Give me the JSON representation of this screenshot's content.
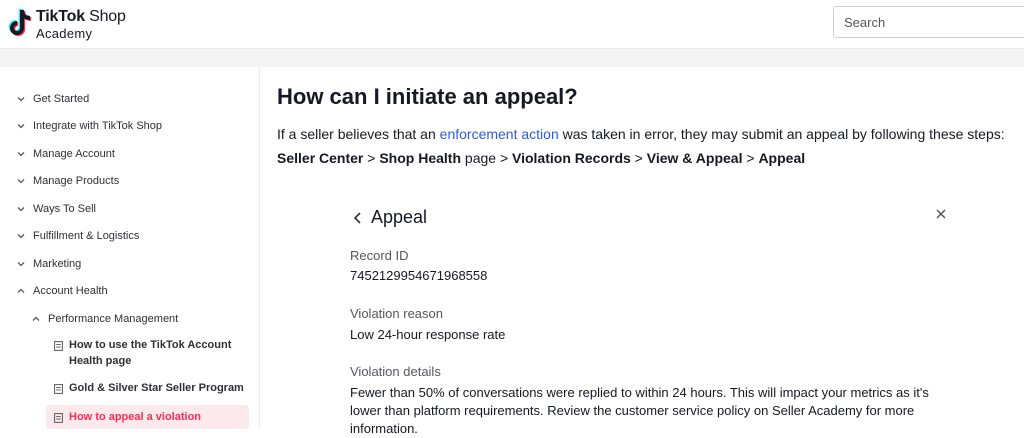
{
  "header": {
    "logo_bold": "TikTok",
    "logo_thin": " Shop",
    "logo_sub": "Academy",
    "search_placeholder": "Search"
  },
  "sidebar": {
    "items": [
      {
        "label": "Get Started"
      },
      {
        "label": "Integrate with TikTok Shop"
      },
      {
        "label": "Manage Account"
      },
      {
        "label": "Manage Products"
      },
      {
        "label": "Ways To Sell"
      },
      {
        "label": "Fulfillment & Logistics"
      },
      {
        "label": "Marketing"
      },
      {
        "label": "Account Health"
      }
    ],
    "sub": {
      "label": "Performance Management"
    },
    "leaves": [
      {
        "line1": "How to use the TikTok Account",
        "line2": "Health page"
      },
      {
        "line1": "Gold & Silver Star Seller Program"
      },
      {
        "line1": "How to appeal a violation"
      }
    ],
    "colors": {
      "active_text": "#fe2c55",
      "active_bg": "#fce9ec"
    }
  },
  "main": {
    "title": "How can I initiate an appeal?",
    "para_before": "If a seller believes that an ",
    "para_link": "enforcement action",
    "para_after": " was taken in error, they may submit an appeal by following these steps:",
    "steps": [
      {
        "text": "Seller Center",
        "bold": true
      },
      {
        "text": " > ",
        "bold": false
      },
      {
        "text": "Shop Health",
        "bold": true
      },
      {
        "text": " page > ",
        "bold": false
      },
      {
        "text": "Violation Records",
        "bold": true
      },
      {
        "text": " > ",
        "bold": false
      },
      {
        "text": "View & Appeal",
        "bold": true
      },
      {
        "text": " > ",
        "bold": false
      },
      {
        "text": "Appeal",
        "bold": true
      }
    ],
    "link_color": "#2c5cd8"
  },
  "modal": {
    "title": "Appeal",
    "record_id_label": "Record ID",
    "record_id_value": "7452129954671968558",
    "reason_label": "Violation reason",
    "reason_value": "Low 24-hour response rate",
    "details_label": "Violation details",
    "details_value": "Fewer than 50% of conversations were replied to within 24 hours. This will impact your metrics as it's lower than platform requirements. Review the customer service policy on Seller Academy for more information."
  }
}
